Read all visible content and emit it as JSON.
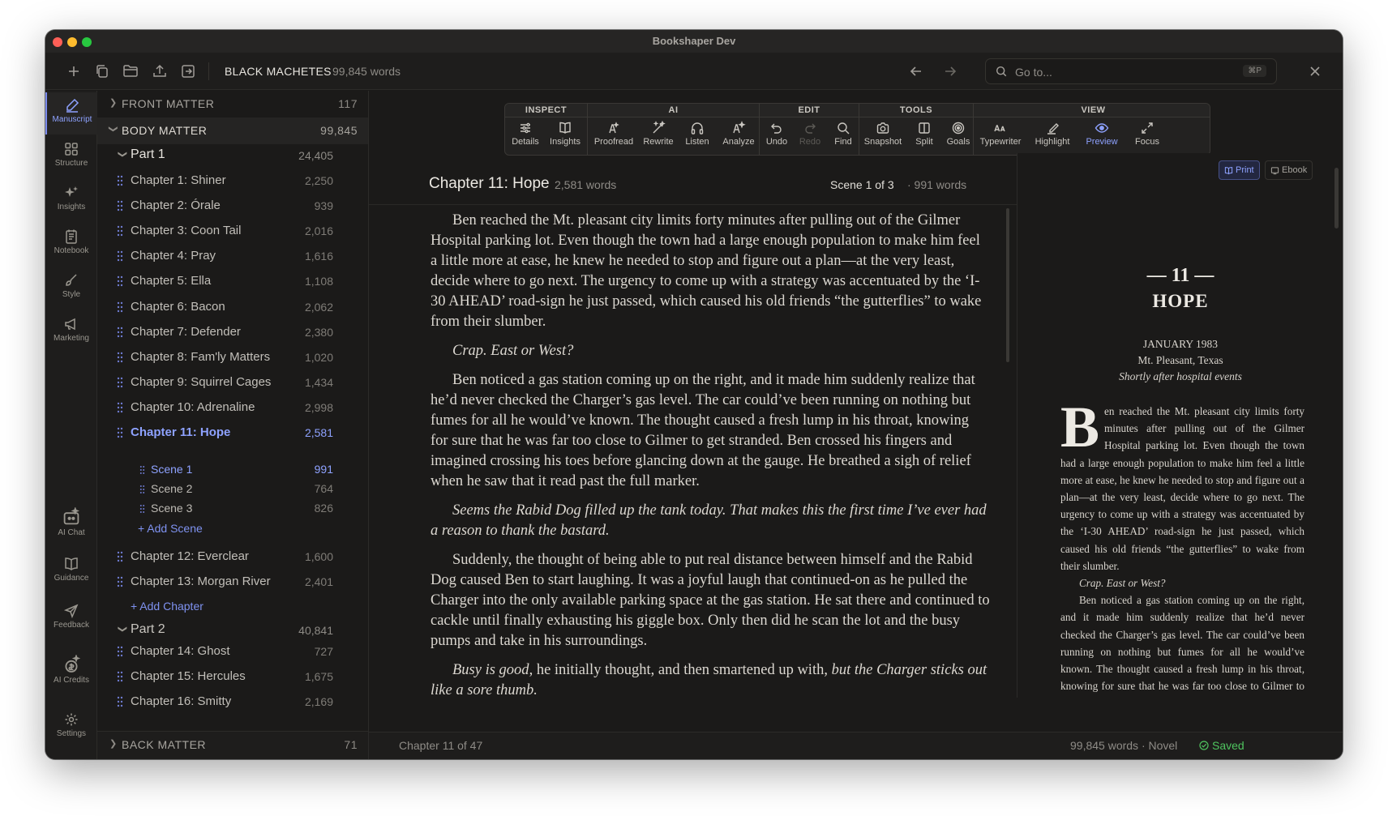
{
  "window": {
    "title": "Bookshaper Dev"
  },
  "toolbar": {
    "book_title": "BLACK MACHETES",
    "book_words": "99,845 words",
    "goto_placeholder": "Go to...",
    "goto_shortcut": "⌘P",
    "icons": [
      "plus-icon",
      "duplicate-icon",
      "folder-icon",
      "upload-icon",
      "export-icon",
      "arrow-left-icon",
      "arrow-right-icon",
      "search-icon",
      "close-icon"
    ]
  },
  "rail": {
    "top": [
      {
        "label": "Manuscript",
        "icon": "pen-icon",
        "active": true
      },
      {
        "label": "Structure",
        "icon": "grid-icon"
      },
      {
        "label": "Insights",
        "icon": "sparkle-icon"
      },
      {
        "label": "Notebook",
        "icon": "notebook-icon"
      },
      {
        "label": "Style",
        "icon": "brush-icon"
      },
      {
        "label": "Marketing",
        "icon": "megaphone-icon"
      }
    ],
    "bottom": [
      {
        "label": "AI Chat",
        "icon": "ai-chat-icon"
      },
      {
        "label": "Guidance",
        "icon": "book-open-icon"
      },
      {
        "label": "Feedback",
        "icon": "send-icon"
      },
      {
        "label": "AI Credits",
        "icon": "credits-icon"
      },
      {
        "label": "Settings",
        "icon": "gear-icon"
      }
    ]
  },
  "sidebar": {
    "front_matter": {
      "label": "FRONT MATTER",
      "count": "117"
    },
    "body_matter": {
      "label": "BODY MATTER",
      "count": "99,845"
    },
    "back_matter": {
      "label": "BACK MATTER",
      "count": "71"
    },
    "part1": {
      "label": "Part 1",
      "count": "24,405"
    },
    "part2": {
      "label": "Part 2",
      "count": "40,841"
    },
    "chapters": [
      {
        "label": "Chapter 1: Shiner",
        "count": "2,250"
      },
      {
        "label": "Chapter 2: Órale",
        "count": "939"
      },
      {
        "label": "Chapter 3: Coon Tail",
        "count": "2,016"
      },
      {
        "label": "Chapter 4: Pray",
        "count": "1,616"
      },
      {
        "label": "Chapter 5: Ella",
        "count": "1,108"
      },
      {
        "label": "Chapter 6: Bacon",
        "count": "2,062"
      },
      {
        "label": "Chapter 7: Defender",
        "count": "2,380"
      },
      {
        "label": "Chapter 8: Fam'ly Matters",
        "count": "1,020"
      },
      {
        "label": "Chapter 9: Squirrel Cages",
        "count": "1,434"
      },
      {
        "label": "Chapter 10: Adrenaline",
        "count": "2,998"
      },
      {
        "label": "Chapter 11: Hope",
        "count": "2,581"
      },
      {
        "label": "Chapter 12: Everclear",
        "count": "1,600"
      },
      {
        "label": "Chapter 13: Morgan River",
        "count": "2,401"
      },
      {
        "label": "Chapter 14: Ghost",
        "count": "727"
      },
      {
        "label": "Chapter 15: Hercules",
        "count": "1,675"
      },
      {
        "label": "Chapter 16: Smitty",
        "count": "2,169"
      }
    ],
    "scenes": [
      {
        "label": "Scene 1",
        "count": "991"
      },
      {
        "label": "Scene 2",
        "count": "764"
      },
      {
        "label": "Scene 3",
        "count": "826"
      }
    ],
    "add_scene": "+ Add Scene",
    "add_chapter": "+ Add Chapter"
  },
  "ribbon": {
    "groups": [
      {
        "label": "INSPECT",
        "buttons": [
          {
            "label": "Details",
            "icon": "sliders-icon"
          },
          {
            "label": "Insights",
            "icon": "book-open-icon"
          }
        ]
      },
      {
        "label": "AI",
        "buttons": [
          {
            "label": "Proofread",
            "icon": "proofread-icon"
          },
          {
            "label": "Rewrite",
            "icon": "wand-icon"
          },
          {
            "label": "Listen",
            "icon": "headphones-icon"
          },
          {
            "label": "Analyze",
            "icon": "analyze-icon"
          }
        ]
      },
      {
        "label": "EDIT",
        "buttons": [
          {
            "label": "Undo",
            "icon": "undo-icon"
          },
          {
            "label": "Redo",
            "icon": "redo-icon"
          },
          {
            "label": "Find",
            "icon": "search-icon"
          }
        ]
      },
      {
        "label": "TOOLS",
        "buttons": [
          {
            "label": "Snapshot",
            "icon": "camera-icon"
          },
          {
            "label": "Split",
            "icon": "split-icon"
          },
          {
            "label": "Goals",
            "icon": "target-icon"
          }
        ]
      },
      {
        "label": "VIEW",
        "buttons": [
          {
            "label": "Typewriter",
            "icon": "typewriter-icon"
          },
          {
            "label": "Highlight",
            "icon": "highlighter-icon"
          },
          {
            "label": "Preview",
            "icon": "eye-icon"
          },
          {
            "label": "Focus",
            "icon": "expand-icon"
          }
        ]
      }
    ]
  },
  "editor": {
    "chapter_title": "Chapter 11: Hope",
    "chapter_words": "2,581 words",
    "scene_info": "Scene 1 of 3",
    "scene_words": "· 991 words",
    "paragraphs": [
      {
        "text": "Ben reached the Mt. pleasant city limits forty minutes after pulling out of the Gilmer Hospital parking lot. Even though the town had a large enough population to make him feel a little more at ease, he knew he needed to stop and figure out a plan—at the very least, decide where to go next. The urgency to come up with a strategy was accentuated by the ‘I-30 AHEAD’ road-sign he just passed, which caused his old friends “the gutterflies” to wake from their slumber.",
        "italic": false
      },
      {
        "text": "Crap. East or West?",
        "italic": true
      },
      {
        "text": "Ben noticed a gas station coming up on the right, and it made him suddenly realize that he’d never checked the Charger’s gas level. The car could’ve been running on nothing but fumes for all he would’ve known. The thought caused a fresh lump in his throat, knowing for sure that he was far too close to Gilmer to get stranded. Ben crossed his fingers and imagined crossing his toes before glancing down at the gauge. He breathed a sigh of relief when he saw that it read past the full marker.",
        "italic": false
      },
      {
        "text": "Seems the Rabid Dog filled up the tank today. That makes this the first time I’ve ever had a reason to thank the bastard.",
        "italic": true
      },
      {
        "text": "Suddenly, the thought of being able to put real distance between himself and the Rabid Dog caused Ben to start laughing. It was a joyful laugh that continued-on as he pulled the Charger into the only available parking space at the gas station. He sat there and continued to cackle until finally exhausting his giggle box. Only then did he scan the lot and the busy pumps and take in his surroundings.",
        "italic": false
      }
    ],
    "last_para": {
      "a": "Busy is good",
      "b": ", he initially thought, and then smartened up with, ",
      "c": "but the Charger sticks out like a sore thumb."
    }
  },
  "preview": {
    "tab_print": "Print",
    "tab_ebook": "Ebook",
    "chapter_num": "— 11 —",
    "chapter_head": "HOPE",
    "date": "JANUARY 1983",
    "location": "Mt. Pleasant, Texas",
    "note": "Shortly after hospital events",
    "dropcap": "B",
    "p1": "en reached the Mt. pleasant city limits forty minutes after pulling out of the Gilmer Hospital parking lot. Even though the town had a large enough population to make him feel a little more at ease, he knew he needed to stop and figure out a plan—at the very least, decide where to go next. The urgency to come up with a strategy was accentuated by the ‘I-30 AHEAD’ road-sign he just passed, which caused his old friends “the gutterflies” to wake from their slumber.",
    "p2": "Crap. East or West?",
    "p3": "Ben noticed a gas station coming up on the right, and it made him suddenly realize that he’d never checked the Charger’s gas level. The car could’ve been running on nothing but fumes for all he would’ve known. The thought caused a fresh lump in his throat, knowing for sure that he was far too close to Gilmer to get stranded. Ben crossed"
  },
  "status": {
    "chapter_pos": "Chapter 11 of 47",
    "summary": "99,845 words · Novel",
    "saved": "Saved"
  },
  "colors": {
    "accent": "#8ea2ff",
    "saved": "#4fc45f",
    "background": "#1b1a19"
  }
}
